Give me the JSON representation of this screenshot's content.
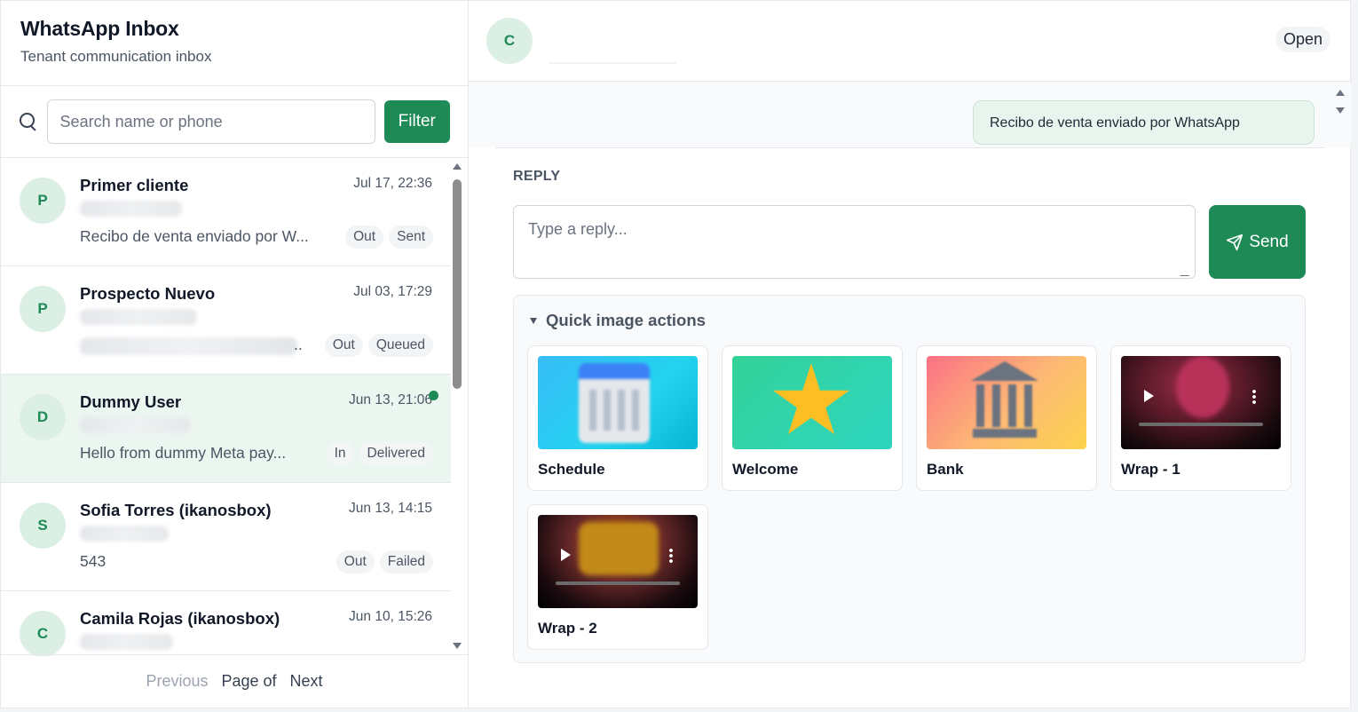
{
  "sidebar": {
    "title": "WhatsApp Inbox",
    "subtitle": "Tenant communication inbox",
    "search_placeholder": "Search name or phone",
    "filter_label": "Filter",
    "conversations": [
      {
        "initial": "P",
        "name": "Primer cliente",
        "time": "Jul 17, 22:36",
        "preview": "Recibo de venta enviado por W...",
        "direction": "Out",
        "status": "Sent"
      },
      {
        "initial": "P",
        "name": "Prospecto Nuevo",
        "time": "Jul 03, 17:29",
        "preview": "..",
        "direction": "Out",
        "status": "Queued"
      },
      {
        "initial": "D",
        "name": "Dummy User",
        "time": "Jun 13, 21:06",
        "preview": "Hello from dummy Meta pay...",
        "direction": "In",
        "status": "Delivered"
      },
      {
        "initial": "S",
        "name": "Sofia Torres (ikanosbox)",
        "time": "Jun 13, 14:15",
        "preview": "543",
        "direction": "Out",
        "status": "Failed"
      },
      {
        "initial": "C",
        "name": "Camila Rojas (ikanosbox)",
        "time": "Jun 10, 15:26",
        "preview": "",
        "direction": "",
        "status": ""
      }
    ],
    "pager": {
      "previous": "Previous",
      "page_of": "Page of",
      "next": "Next"
    }
  },
  "main": {
    "avatar_initial": "C",
    "status": "Open",
    "message_preview": "Recibo de venta enviado por WhatsApp",
    "reply_label": "REPLY",
    "reply_placeholder": "Type a reply...",
    "send_label": "Send",
    "quick_actions_title": "Quick image actions",
    "quick_actions": [
      {
        "label": "Schedule"
      },
      {
        "label": "Welcome"
      },
      {
        "label": "Bank"
      },
      {
        "label": "Wrap - 1"
      },
      {
        "label": "Wrap - 2"
      }
    ]
  },
  "colors": {
    "brand": "#1e8a56",
    "active_row": "#ecf6f0"
  }
}
